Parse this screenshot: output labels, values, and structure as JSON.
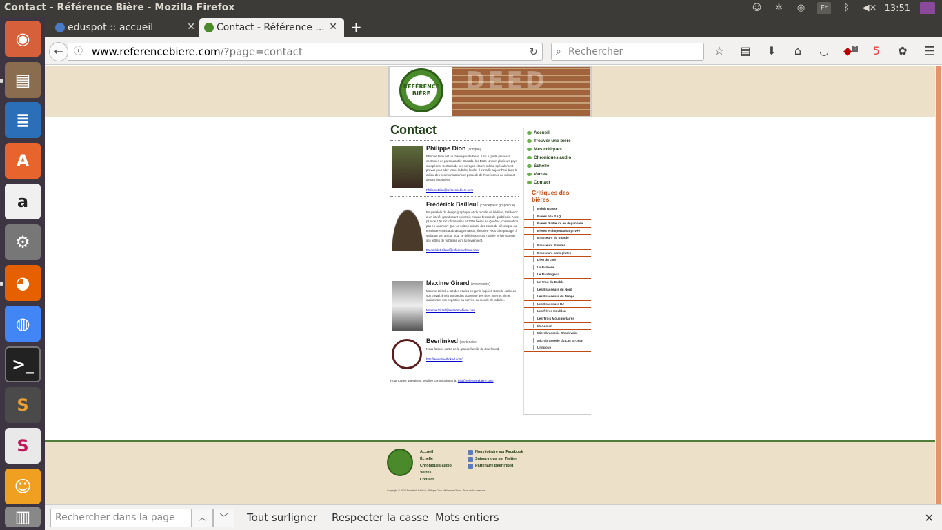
{
  "window": {
    "title": "Contact - Référence Bière - Mozilla Firefox"
  },
  "tray": {
    "keyboard": "Fr",
    "time": "13:51"
  },
  "tabs": [
    {
      "label": "eduspot :: accueil"
    },
    {
      "label": "Contact - Référence ..."
    }
  ],
  "navbar": {
    "url_host": "www.referencebiere.com",
    "url_path": "/?page=contact",
    "search_placeholder": "Rechercher",
    "ublock_badge": "5"
  },
  "page": {
    "title": "Contact",
    "header_sign": "DEED",
    "logo_text": "RÉFÉRENCE BIÈRE",
    "people": [
      {
        "name": "Philippe Dion",
        "role": "(critique)",
        "bio": "Philippe Dion est un maniaque de bière. Il en a goûté plusieurs centaines en parcourant le Canada, les États-Unis et plusieurs pays européens. Certains de ces voyages étaient même spécialement prévus pour aller tester la bière locale. Il travaille aujourd'hui dans le milieu des communications et possède de l'expérience au micro et devant la caméra.",
        "email": "Philippe.Dion@referencebiere.com"
      },
      {
        "name": "Frédérick Bailleul",
        "role": "(concepteur graphique)",
        "bio": "En parallèle du design graphique et du monde de l'édition, Frédérick a un intérêt grandissant envers le monde brassicole québécois. Avec plus de 100 microbrasseries et 1000 bières au Québec, comment ne pas en avoir un? Que ce soit en suivant des cours de biérologue ou en s'intéressant au brassage maison, il espère vous faire partager à sa façon son amour pour ce délicieux nectar maltée et lui redonner ses lettres de noblesse qu'il lui reviennent.",
        "email": "Frederick.Bailleul@referencebiere.com"
      },
      {
        "name": "Maxime Girard",
        "role": "(webmestre)",
        "bio": "Maxime Girard a fait des études en génie logiciel. Dans le cadre de son travail, il met sur pied et supervise des sites Internet. Il met maintenant son expertise au service du monde de la bière.",
        "email": "Maxime.Girard@referencebiere.com"
      },
      {
        "name": "Beerlinked",
        "role": "(partenaire)",
        "bio": "Nous faisons partie de la grande famille de Beerlinked.",
        "email": "http://www.beerlinked.com/"
      }
    ],
    "endnote_text": "Pour toutes questions, veuillez communiquer à:",
    "endnote_link": "info@referencebiere.com"
  },
  "sidebar": {
    "nav": [
      "Accueil",
      "Trouver une bière",
      "Mes critiques",
      "Chroniques audio",
      "Échelle",
      "Verres",
      "Contact"
    ],
    "critiques_title": "Critiques des bières",
    "brewers": [
      "Belgh Brasse",
      "Bières à la SAQ",
      "Bières d'ailleurs en dépanneur",
      "Bières en importation privée",
      "Brasseurs du monde",
      "Brasseurs Illimités",
      "Brasseurs sans gluten",
      "Dieu du ciel!",
      "La Barberie",
      "Le Naufrageur",
      "Le Trou du Diable",
      "Les Brasseurs du Nord",
      "Les Brasseurs du Temps",
      "Les Brasseurs RJ",
      "Les frères Houblon",
      "Les Trois Mousquetaires",
      "McAuslan",
      "Microbrasserie Charlevoix",
      "Microbrasserie du Lac St-Jean",
      "Unibroue"
    ]
  },
  "footer": {
    "links": [
      "Accueil",
      "Échelle",
      "Chroniques audio",
      "Verres",
      "Contact"
    ],
    "social": [
      "Nous joindre sur Facebook",
      "Suivez-nous sur Twitter",
      "Partenaire Beerlinked"
    ],
    "copyright": "Copyright © 2013 Frédérick Bailleul, Philippe Dion et Maxime Girard. Tous droits réservés."
  },
  "findbar": {
    "placeholder": "Rechercher dans la page",
    "highlight_all": "Tout surligner",
    "match_case": "Respecter la casse",
    "whole_words": "Mots entiers"
  }
}
